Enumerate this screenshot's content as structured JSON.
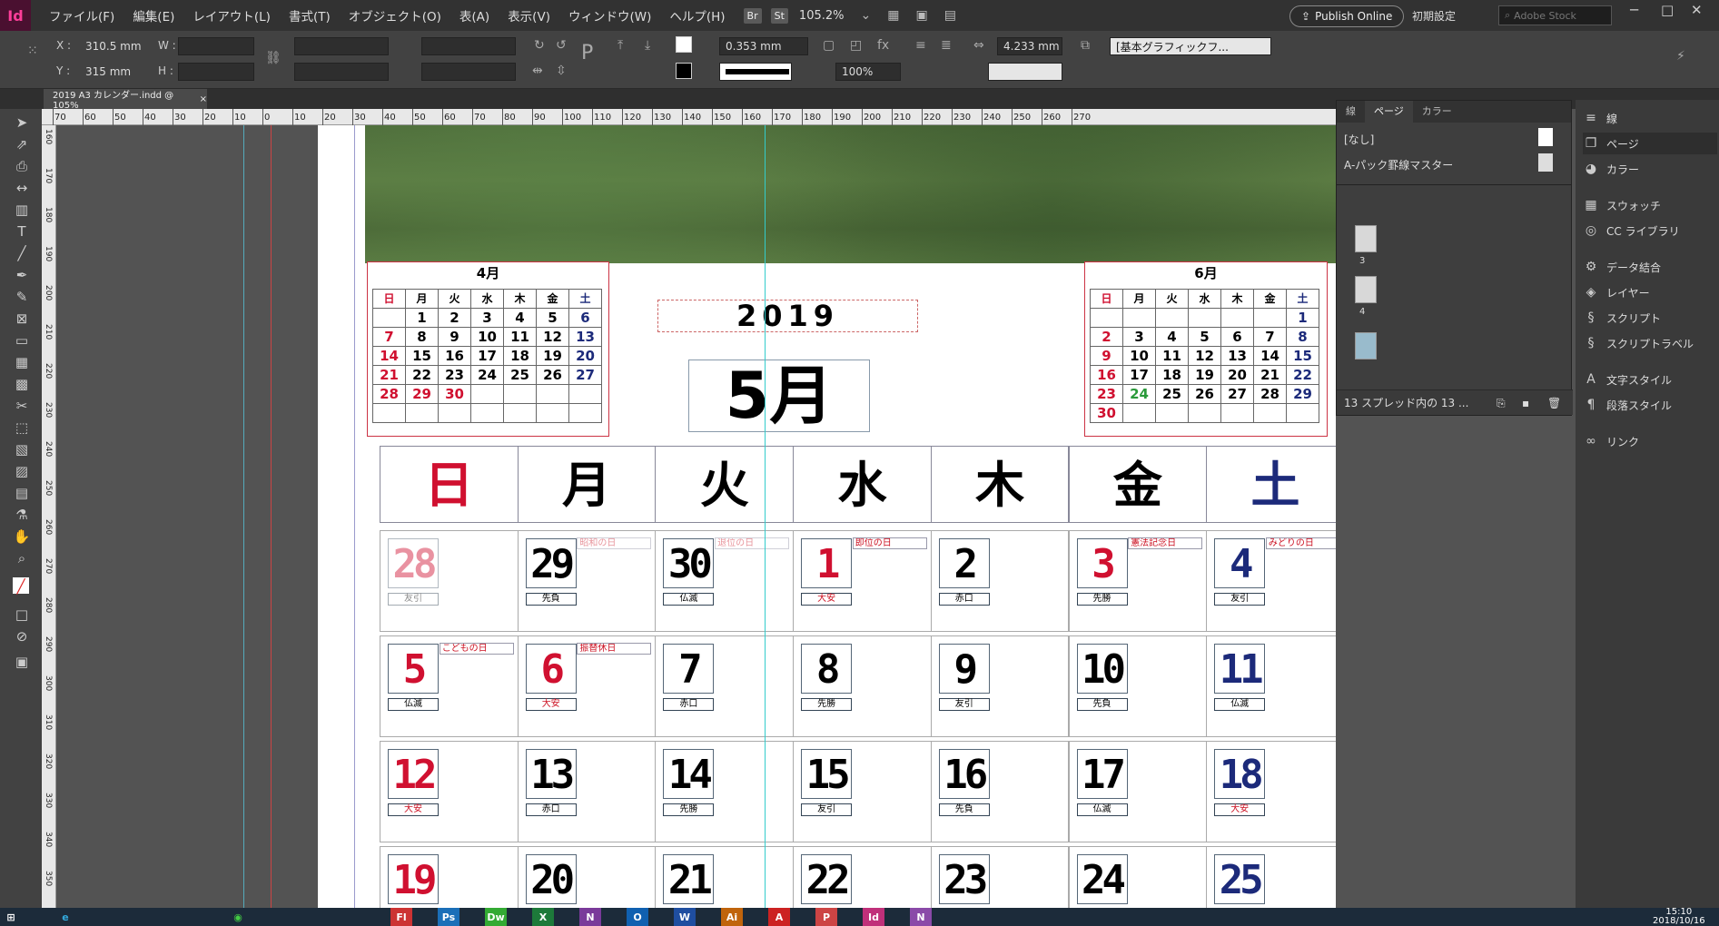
{
  "menubar": {
    "app_icon": "Id",
    "items": [
      "ファイル(F)",
      "編集(E)",
      "レイアウト(L)",
      "書式(T)",
      "オブジェクト(O)",
      "表(A)",
      "表示(V)",
      "ウィンドウ(W)",
      "ヘルプ(H)"
    ],
    "badge_br": "Br",
    "badge_st": "St",
    "zoom": "105.2%",
    "publish": "Publish Online",
    "workspace": "初期設定",
    "stock_placeholder": "Adobe Stock"
  },
  "control": {
    "x_label": "X :",
    "x_value": "310.5 mm",
    "y_label": "Y :",
    "y_value": "315 mm",
    "w_label": "W :",
    "h_label": "H :",
    "stroke_weight": "0.353 mm",
    "scale": "100%",
    "gap": "4.233 mm",
    "object_style": "[基本グラフィックフ..."
  },
  "document": {
    "tab_title": "2019 A3 カレンダー.indd @ 105%",
    "close": "×"
  },
  "ruler": {
    "h_ticks": [
      "70",
      "60",
      "50",
      "40",
      "30",
      "20",
      "10",
      "0",
      "10",
      "20",
      "30",
      "40",
      "50",
      "60",
      "70",
      "80",
      "90",
      "100",
      "110",
      "120",
      "130",
      "140",
      "150",
      "160",
      "170",
      "180",
      "190",
      "200",
      "210",
      "220",
      "230",
      "240",
      "250",
      "260",
      "270"
    ],
    "v_ticks": [
      "160",
      "170",
      "180",
      "190",
      "200",
      "210",
      "220",
      "230",
      "240",
      "250",
      "260",
      "270",
      "280",
      "290",
      "300",
      "310",
      "320",
      "330",
      "340",
      "350"
    ]
  },
  "calendar": {
    "year": "2019",
    "month": "5月",
    "prev": {
      "title": "4月",
      "headers": [
        "日",
        "月",
        "火",
        "水",
        "木",
        "金",
        "土"
      ],
      "rows": [
        [
          "",
          "1",
          "2",
          "3",
          "4",
          "5",
          "6"
        ],
        [
          "7",
          "8",
          "9",
          "10",
          "11",
          "12",
          "13"
        ],
        [
          "14",
          "15",
          "16",
          "17",
          "18",
          "19",
          "20"
        ],
        [
          "21",
          "22",
          "23",
          "24",
          "25",
          "26",
          "27"
        ],
        [
          "28",
          "29",
          "30",
          "",
          "",
          "",
          ""
        ],
        [
          "",
          "",
          "",
          "",
          "",
          "",
          ""
        ]
      ]
    },
    "next": {
      "title": "6月",
      "headers": [
        "日",
        "月",
        "火",
        "水",
        "木",
        "金",
        "土"
      ],
      "rows": [
        [
          "",
          "",
          "",
          "",
          "",
          "",
          "1"
        ],
        [
          "2",
          "3",
          "4",
          "5",
          "6",
          "7",
          "8"
        ],
        [
          "9",
          "10",
          "11",
          "12",
          "13",
          "14",
          "15"
        ],
        [
          "16",
          "17",
          "18",
          "19",
          "20",
          "21",
          "22"
        ],
        [
          "23",
          "24",
          "25",
          "26",
          "27",
          "28",
          "29"
        ],
        [
          "30",
          "",
          "",
          "",
          "",
          "",
          ""
        ]
      ]
    },
    "dow": [
      "日",
      "月",
      "火",
      "水",
      "木",
      "金",
      "土"
    ],
    "weeks": [
      [
        {
          "d": "28",
          "r": "友引",
          "h": "",
          "f": true
        },
        {
          "d": "29",
          "r": "先負",
          "h": "昭和の日",
          "f": false
        },
        {
          "d": "30",
          "r": "仏滅",
          "h": "退位の日",
          "f": false
        },
        {
          "d": "1",
          "r": "大安",
          "h": "即位の日",
          "f": false
        },
        {
          "d": "2",
          "r": "赤口",
          "h": "",
          "f": false
        },
        {
          "d": "3",
          "r": "先勝",
          "h": "憲法記念日",
          "f": false
        },
        {
          "d": "4",
          "r": "友引",
          "h": "みどりの日",
          "f": false
        }
      ],
      [
        {
          "d": "5",
          "r": "仏滅",
          "h": "こどもの日",
          "f": false
        },
        {
          "d": "6",
          "r": "大安",
          "h": "振替休日",
          "f": false
        },
        {
          "d": "7",
          "r": "赤口",
          "h": "",
          "f": false
        },
        {
          "d": "8",
          "r": "先勝",
          "h": "",
          "f": false
        },
        {
          "d": "9",
          "r": "友引",
          "h": "",
          "f": false
        },
        {
          "d": "10",
          "r": "先負",
          "h": "",
          "f": false
        },
        {
          "d": "11",
          "r": "仏滅",
          "h": "",
          "f": false
        }
      ],
      [
        {
          "d": "12",
          "r": "大安",
          "h": "",
          "f": false
        },
        {
          "d": "13",
          "r": "赤口",
          "h": "",
          "f": false
        },
        {
          "d": "14",
          "r": "先勝",
          "h": "",
          "f": false
        },
        {
          "d": "15",
          "r": "友引",
          "h": "",
          "f": false
        },
        {
          "d": "16",
          "r": "先負",
          "h": "",
          "f": false
        },
        {
          "d": "17",
          "r": "仏滅",
          "h": "",
          "f": false
        },
        {
          "d": "18",
          "r": "大安",
          "h": "",
          "f": false
        }
      ],
      [
        {
          "d": "19",
          "r": "",
          "h": "",
          "f": false
        },
        {
          "d": "20",
          "r": "",
          "h": "",
          "f": false
        },
        {
          "d": "21",
          "r": "",
          "h": "",
          "f": false
        },
        {
          "d": "22",
          "r": "",
          "h": "",
          "f": false
        },
        {
          "d": "23",
          "r": "",
          "h": "",
          "f": false
        },
        {
          "d": "24",
          "r": "",
          "h": "",
          "f": false
        },
        {
          "d": "25",
          "r": "",
          "h": "",
          "f": false
        }
      ]
    ]
  },
  "pages_panel": {
    "tabs": [
      "線",
      "ページ",
      "カラー"
    ],
    "none_master": "[なし]",
    "master": "A-パック罫線マスター",
    "thumbs": [
      "3",
      "4"
    ],
    "footer": "13 スプレッド内の 13 ..."
  },
  "right_panel": {
    "items": [
      "線",
      "ページ",
      "カラー",
      "スウォッチ",
      "CC ライブラリ",
      "データ結合",
      "レイヤー",
      "スクリプト",
      "スクリプトラベル",
      "文字スタイル",
      "段落スタイル",
      "リンク"
    ]
  },
  "taskbar": {
    "time": "15:10",
    "date": "2018/10/16",
    "apps": [
      "Fl",
      "Ps",
      "Dw",
      "X",
      "N",
      "O",
      "W",
      "Ai",
      "A",
      "P",
      "Id",
      "N"
    ]
  }
}
